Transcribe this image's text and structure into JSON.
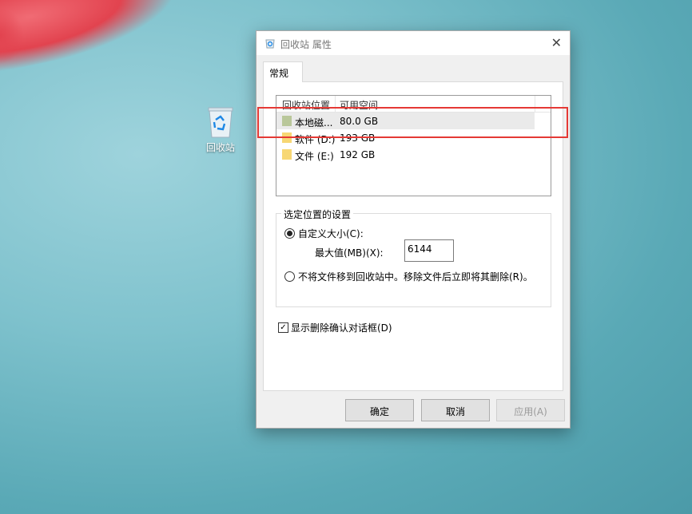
{
  "desktop": {
    "recycle_bin_label": "回收站"
  },
  "dialog": {
    "title": "回收站 属性",
    "close_glyph": "✕",
    "tab_label": "常规",
    "list": {
      "columns": [
        "回收站位置",
        "可用空间"
      ],
      "rows": [
        {
          "name": "本地磁...",
          "free": "80.0 GB",
          "icon_color": "#b9c79a"
        },
        {
          "name": "软件 (D:)",
          "free": "193 GB",
          "icon_color": "#f7d774"
        },
        {
          "name": "文件 (E:)",
          "free": "192 GB",
          "icon_color": "#f7d774"
        }
      ]
    },
    "settings": {
      "group_label": "选定位置的设置",
      "custom_size_label": "自定义大小(C):",
      "max_size_label": "最大值(MB)(X):",
      "max_size_value": "6144",
      "no_move_label": "不将文件移到回收站中。移除文件后立即将其删除(R)。",
      "confirm_label": "显示删除确认对话框(D)",
      "custom_size_selected": true,
      "confirm_checked": true
    },
    "buttons": {
      "ok": "确定",
      "cancel": "取消",
      "apply": "应用(A)"
    }
  },
  "colors": {
    "annotation": "#e53935"
  }
}
